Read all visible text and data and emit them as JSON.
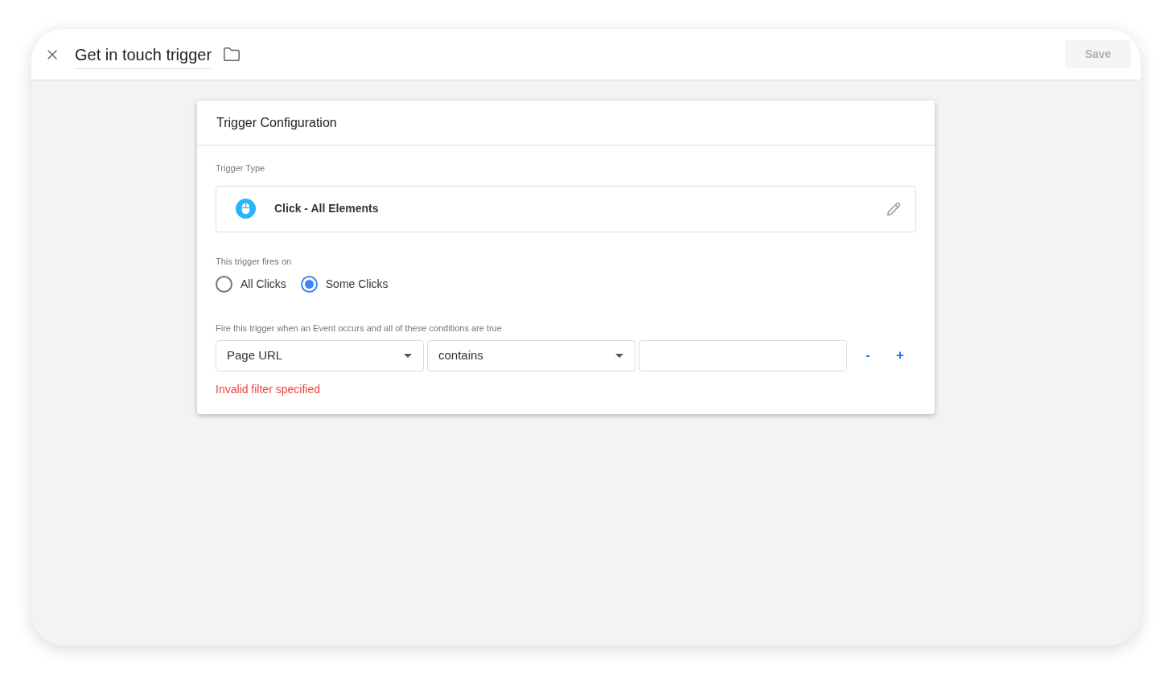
{
  "header": {
    "title": "Get in touch trigger",
    "save_button": {
      "label": "Save",
      "disabled": true
    }
  },
  "card": {
    "title": "Trigger Configuration",
    "trigger_type": {
      "label": "Trigger Type",
      "value": "Click - All Elements"
    },
    "fires_on": {
      "label": "This trigger fires on",
      "options": [
        {
          "label": "All Clicks",
          "selected": false
        },
        {
          "label": "Some Clicks",
          "selected": true
        }
      ]
    },
    "conditions": {
      "label": "Fire this trigger when an Event occurs and all of these conditions are true",
      "variable": "Page URL",
      "operator": "contains",
      "remove": "-",
      "add": "+",
      "error": "Invalid filter specified"
    }
  }
}
